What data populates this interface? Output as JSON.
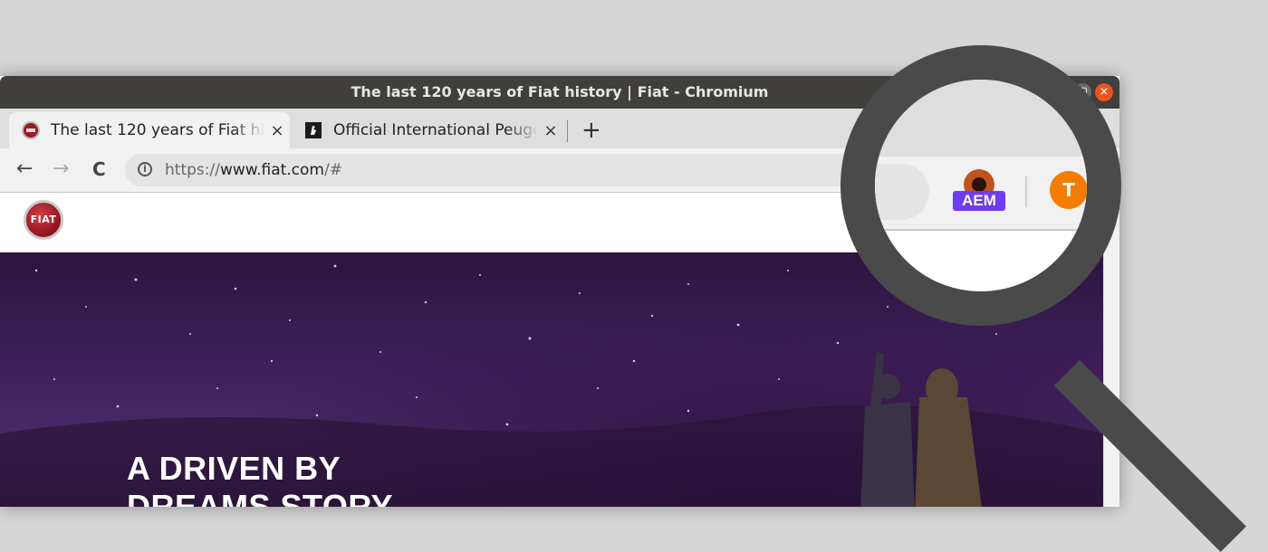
{
  "window": {
    "title": "The last 120 years of Fiat history | Fiat - Chromium",
    "close_glyph": "×",
    "maximize_glyph": "▢"
  },
  "tabs": [
    {
      "label": "The last 120 years of Fiat history | Fiat",
      "close": "×",
      "active": true,
      "favicon": "fiat-favicon-icon"
    },
    {
      "label": "Official International Peugeot Website",
      "close": "×",
      "active": false,
      "favicon": "peugeot-favicon-icon"
    }
  ],
  "new_tab_glyph": "+",
  "toolbar": {
    "back_glyph": "←",
    "forward_glyph": "→",
    "reload_glyph": "C",
    "info_glyph": "i",
    "url_scheme": "https://",
    "url_host": "www.fiat.com",
    "url_path": "/#"
  },
  "site": {
    "logo_text": "FIAT"
  },
  "hero": {
    "headline_line1": "A DRIVEN BY",
    "headline_line2": "DREAMS STORY"
  },
  "magnified": {
    "star_glyph": "☆",
    "extension_badge": "AEM",
    "avatar_letter": "T"
  },
  "colors": {
    "titlebar": "#403f3b",
    "close_button": "#e95420",
    "aem_badge": "#6f3cf0",
    "avatar": "#f57c00",
    "hero_sky": "#40205c"
  }
}
